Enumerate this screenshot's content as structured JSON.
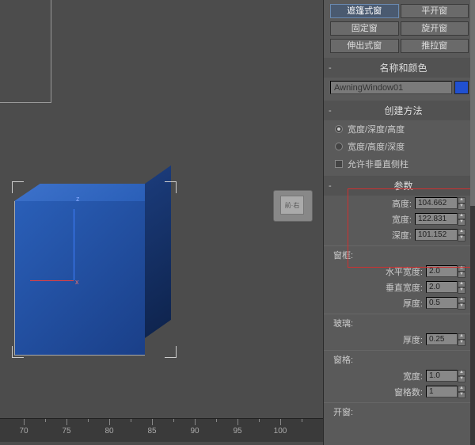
{
  "window_types": {
    "row1": {
      "a": "遮篷式窗",
      "b": "平开窗"
    },
    "row2": {
      "a": "固定窗",
      "b": "旋开窗"
    },
    "row3": {
      "a": "伸出式窗",
      "b": "推拉窗"
    }
  },
  "sections": {
    "name_color": "名称和颜色",
    "create_method": "创建方法",
    "params": "参数"
  },
  "object_name": "AwningWindow01",
  "create_method": {
    "opt1": "宽度/深度/高度",
    "opt2": "宽度/高度/深度",
    "allow_non_vert": "允许非垂直侧柱"
  },
  "params": {
    "height": {
      "label": "高度:",
      "value": "104.662"
    },
    "width": {
      "label": "宽度:",
      "value": "122.831"
    },
    "depth": {
      "label": "深度:",
      "value": "101.152"
    }
  },
  "frame": {
    "title": "窗框:",
    "h_width": {
      "label": "水平宽度:",
      "value": "2.0"
    },
    "v_width": {
      "label": "垂直宽度:",
      "value": "2.0"
    },
    "thickness": {
      "label": "厚度:",
      "value": "0.5"
    }
  },
  "glass": {
    "title": "玻璃:",
    "thickness": {
      "label": "厚度:",
      "value": "0.25"
    }
  },
  "grid": {
    "title": "窗格:",
    "width": {
      "label": "宽度:",
      "value": "1.0"
    },
    "count": {
      "label": "窗格数:",
      "value": "1"
    }
  },
  "open_window": {
    "title": "开窗:"
  },
  "ruler": {
    "marks": [
      "70",
      "75",
      "80",
      "85",
      "90",
      "95",
      "100"
    ]
  },
  "axes": {
    "z": "z",
    "x": "x"
  },
  "nav_cube": "前·右"
}
